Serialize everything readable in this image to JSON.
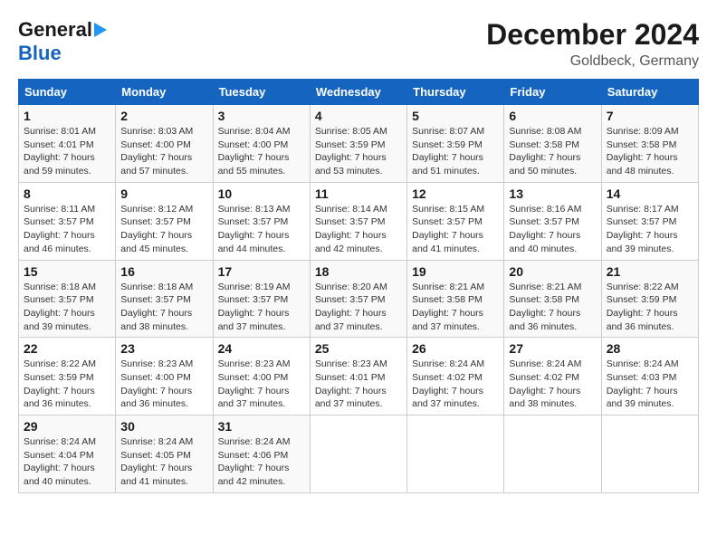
{
  "header": {
    "logo_line1": "General",
    "logo_line2": "Blue",
    "month": "December 2024",
    "location": "Goldbeck, Germany"
  },
  "days_of_week": [
    "Sunday",
    "Monday",
    "Tuesday",
    "Wednesday",
    "Thursday",
    "Friday",
    "Saturday"
  ],
  "weeks": [
    [
      {
        "day": "1",
        "sunrise": "8:01 AM",
        "sunset": "4:01 PM",
        "daylight": "7 hours and 59 minutes."
      },
      {
        "day": "2",
        "sunrise": "8:03 AM",
        "sunset": "4:00 PM",
        "daylight": "7 hours and 57 minutes."
      },
      {
        "day": "3",
        "sunrise": "8:04 AM",
        "sunset": "4:00 PM",
        "daylight": "7 hours and 55 minutes."
      },
      {
        "day": "4",
        "sunrise": "8:05 AM",
        "sunset": "3:59 PM",
        "daylight": "7 hours and 53 minutes."
      },
      {
        "day": "5",
        "sunrise": "8:07 AM",
        "sunset": "3:59 PM",
        "daylight": "7 hours and 51 minutes."
      },
      {
        "day": "6",
        "sunrise": "8:08 AM",
        "sunset": "3:58 PM",
        "daylight": "7 hours and 50 minutes."
      },
      {
        "day": "7",
        "sunrise": "8:09 AM",
        "sunset": "3:58 PM",
        "daylight": "7 hours and 48 minutes."
      }
    ],
    [
      {
        "day": "8",
        "sunrise": "8:11 AM",
        "sunset": "3:57 PM",
        "daylight": "7 hours and 46 minutes."
      },
      {
        "day": "9",
        "sunrise": "8:12 AM",
        "sunset": "3:57 PM",
        "daylight": "7 hours and 45 minutes."
      },
      {
        "day": "10",
        "sunrise": "8:13 AM",
        "sunset": "3:57 PM",
        "daylight": "7 hours and 44 minutes."
      },
      {
        "day": "11",
        "sunrise": "8:14 AM",
        "sunset": "3:57 PM",
        "daylight": "7 hours and 42 minutes."
      },
      {
        "day": "12",
        "sunrise": "8:15 AM",
        "sunset": "3:57 PM",
        "daylight": "7 hours and 41 minutes."
      },
      {
        "day": "13",
        "sunrise": "8:16 AM",
        "sunset": "3:57 PM",
        "daylight": "7 hours and 40 minutes."
      },
      {
        "day": "14",
        "sunrise": "8:17 AM",
        "sunset": "3:57 PM",
        "daylight": "7 hours and 39 minutes."
      }
    ],
    [
      {
        "day": "15",
        "sunrise": "8:18 AM",
        "sunset": "3:57 PM",
        "daylight": "7 hours and 39 minutes."
      },
      {
        "day": "16",
        "sunrise": "8:18 AM",
        "sunset": "3:57 PM",
        "daylight": "7 hours and 38 minutes."
      },
      {
        "day": "17",
        "sunrise": "8:19 AM",
        "sunset": "3:57 PM",
        "daylight": "7 hours and 37 minutes."
      },
      {
        "day": "18",
        "sunrise": "8:20 AM",
        "sunset": "3:57 PM",
        "daylight": "7 hours and 37 minutes."
      },
      {
        "day": "19",
        "sunrise": "8:21 AM",
        "sunset": "3:58 PM",
        "daylight": "7 hours and 37 minutes."
      },
      {
        "day": "20",
        "sunrise": "8:21 AM",
        "sunset": "3:58 PM",
        "daylight": "7 hours and 36 minutes."
      },
      {
        "day": "21",
        "sunrise": "8:22 AM",
        "sunset": "3:59 PM",
        "daylight": "7 hours and 36 minutes."
      }
    ],
    [
      {
        "day": "22",
        "sunrise": "8:22 AM",
        "sunset": "3:59 PM",
        "daylight": "7 hours and 36 minutes."
      },
      {
        "day": "23",
        "sunrise": "8:23 AM",
        "sunset": "4:00 PM",
        "daylight": "7 hours and 36 minutes."
      },
      {
        "day": "24",
        "sunrise": "8:23 AM",
        "sunset": "4:00 PM",
        "daylight": "7 hours and 37 minutes."
      },
      {
        "day": "25",
        "sunrise": "8:23 AM",
        "sunset": "4:01 PM",
        "daylight": "7 hours and 37 minutes."
      },
      {
        "day": "26",
        "sunrise": "8:24 AM",
        "sunset": "4:02 PM",
        "daylight": "7 hours and 37 minutes."
      },
      {
        "day": "27",
        "sunrise": "8:24 AM",
        "sunset": "4:02 PM",
        "daylight": "7 hours and 38 minutes."
      },
      {
        "day": "28",
        "sunrise": "8:24 AM",
        "sunset": "4:03 PM",
        "daylight": "7 hours and 39 minutes."
      }
    ],
    [
      {
        "day": "29",
        "sunrise": "8:24 AM",
        "sunset": "4:04 PM",
        "daylight": "7 hours and 40 minutes."
      },
      {
        "day": "30",
        "sunrise": "8:24 AM",
        "sunset": "4:05 PM",
        "daylight": "7 hours and 41 minutes."
      },
      {
        "day": "31",
        "sunrise": "8:24 AM",
        "sunset": "4:06 PM",
        "daylight": "7 hours and 42 minutes."
      },
      null,
      null,
      null,
      null
    ]
  ]
}
